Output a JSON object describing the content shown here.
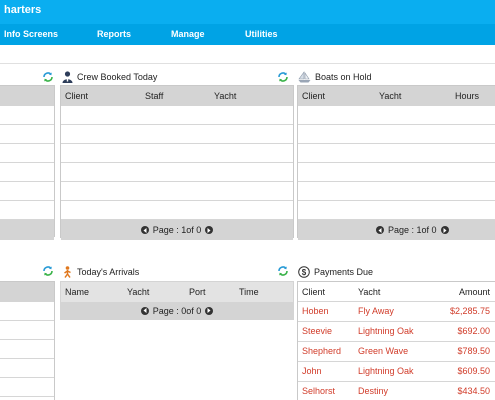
{
  "app": {
    "title": "harters"
  },
  "nav": [
    "Info Screens",
    "Reports",
    "Manage",
    "Utilities"
  ],
  "crew_booked": {
    "title": "Crew Booked Today",
    "columns": [
      "Client",
      "Staff",
      "Yacht"
    ],
    "pager": "Page : 1of 0"
  },
  "boats_on_hold": {
    "title": "Boats on Hold",
    "columns": [
      "Client",
      "Yacht",
      "Hours"
    ],
    "pager": "Page : 1of 0"
  },
  "arrivals": {
    "title": "Today's Arrivals",
    "columns": [
      "Name",
      "Yacht",
      "Port",
      "Time"
    ],
    "pager": "Page : 0of 0"
  },
  "payments": {
    "title": "Payments Due",
    "columns": [
      "Client",
      "Yacht",
      "Amount"
    ],
    "rows": [
      {
        "client": "Hoben",
        "yacht": "Fly Away",
        "amount": "$2,285.75"
      },
      {
        "client": "Steevie",
        "yacht": "Lightning Oak",
        "amount": "$692.00"
      },
      {
        "client": "Shepherd",
        "yacht": "Green Wave",
        "amount": "$789.50"
      },
      {
        "client": "John",
        "yacht": "Lightning Oak",
        "amount": "$609.50"
      },
      {
        "client": "Selhorst",
        "yacht": "Destiny",
        "amount": "$434.50"
      }
    ]
  },
  "colors": {
    "header": "#0aaef0",
    "nav": "#00a3e5",
    "grid_head": "#d4d4d4",
    "payment_text": "#d13c2a",
    "refresh": "#2a9bd6"
  },
  "icons": [
    "refresh-icon",
    "crew-icon",
    "boat-icon",
    "arrival-icon",
    "payment-icon",
    "prev-page-icon",
    "next-page-icon"
  ]
}
